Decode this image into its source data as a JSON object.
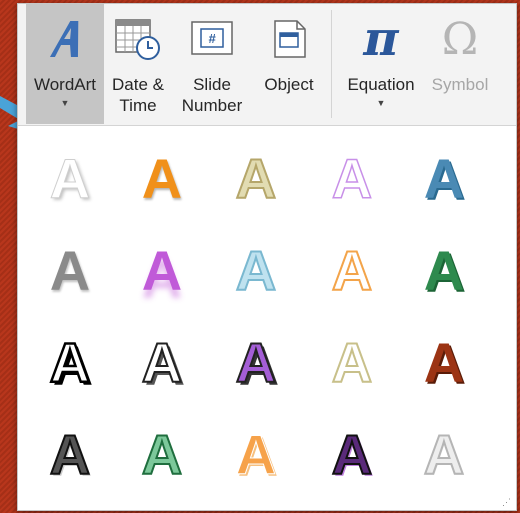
{
  "ribbon": {
    "wordart": {
      "label": "WordArt"
    },
    "datetime": {
      "line1": "Date &",
      "line2": "Time"
    },
    "slidenumber": {
      "line1": "Slide",
      "line2": "Number"
    },
    "object": {
      "label": "Object"
    },
    "equation": {
      "label": "Equation",
      "glyph": "π"
    },
    "symbol": {
      "label": "Symbol",
      "glyph": "Ω"
    }
  },
  "gallery": {
    "glyph": "A",
    "styles": [
      [
        "plain-white-shadow",
        "orange-fill",
        "tan-outline",
        "lavender-outline",
        "blue-gradient"
      ],
      [
        "gray-gradient",
        "purple-reflection",
        "light-blue-outline",
        "orange-outline",
        "green-gradient"
      ],
      [
        "black-outline-white",
        "white-black-shadow",
        "purple-black-outline",
        "tan-light-outline",
        "brown-bevel"
      ],
      [
        "black-stripes",
        "green-stripes",
        "orange-dots",
        "purple-black-pattern",
        "gray-outline-pattern"
      ]
    ]
  },
  "colors": {
    "background": "#b8361c",
    "pointer": "#4aa3d8",
    "equation": "#2b579a",
    "wordart_icon": "#3c6fb6"
  }
}
